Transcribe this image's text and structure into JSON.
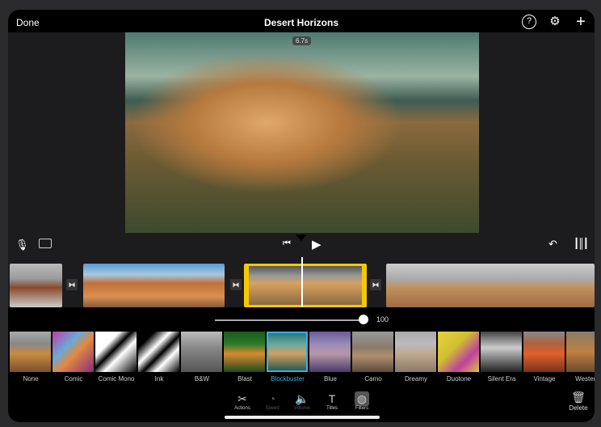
{
  "header": {
    "done_label": "Done",
    "title": "Desert Horizons",
    "icons": [
      "help-icon",
      "settings-icon",
      "add-icon"
    ]
  },
  "viewer": {
    "duration": "6.7s"
  },
  "timeline": {
    "icons": [
      "microphone-icon",
      "camera-icon",
      "skip-back-icon",
      "play-icon",
      "undo-icon",
      "audio-waveform-icon"
    ]
  },
  "slider": {
    "value": "100",
    "fraction": 1.0
  },
  "filters": {
    "selected": "Blockbuster",
    "items": [
      {
        "label": "None",
        "bg": "linear-gradient(#aaa 0%,#888 30%,#c88a40 55%,#7a5030 100%)"
      },
      {
        "label": "Comic",
        "bg": "linear-gradient(135deg,#c23aa0,#6aa8d8 35%,#e08a40 55%,#8a2a80 100%)"
      },
      {
        "label": "Comic Mono",
        "bg": "linear-gradient(135deg,#fff 30%,#000 45%,#fff 60%,#000 100%)"
      },
      {
        "label": "Ink",
        "bg": "linear-gradient(135deg,#000 20%,#fff 40%,#000 55%,#fff 70%,#000 100%)"
      },
      {
        "label": "B&W",
        "bg": "linear-gradient(#bbb,#888 40%,#555 100%)"
      },
      {
        "label": "Blast",
        "bg": "linear-gradient(#1a5a1a,#2a7a2a 30%,#d88a30 55%,#1e4a1e 100%)"
      },
      {
        "label": "Blockbuster",
        "bg": "linear-gradient(#2a7a7a,#6aa8a0 30%,#d0a060 55%,#2a5a50 100%)"
      },
      {
        "label": "Blue",
        "bg": "linear-gradient(#6a5a9a,#9a8ab8 30%,#b898a8 55%,#4a3a6a 100%)"
      },
      {
        "label": "Camo",
        "bg": "linear-gradient(#999,#8a7a6a 40%,#b09070 60%,#5a4a3a 100%)"
      },
      {
        "label": "Dreamy",
        "bg": "linear-gradient(#aaa,#bbb 30%,#c0a890 55%,#8a7a6a 100%)"
      },
      {
        "label": "Duotone",
        "bg": "linear-gradient(135deg,#e8d040,#d0c030 40%,#c040a0 70%,#d8c040 100%)"
      },
      {
        "label": "Silent Era",
        "bg": "linear-gradient(#444,#ccc 40%,#777 70%,#222 100%)"
      },
      {
        "label": "Vintage",
        "bg": "linear-gradient(#888,#b06040 30%,#e0602a 55%,#7a3020 100%)"
      },
      {
        "label": "Western",
        "bg": "linear-gradient(#8a7a6a,#c08040 50%,#6a4a30 100%)"
      }
    ]
  },
  "toolbar": {
    "items": [
      {
        "label": "Actions",
        "icon": "scissors-icon",
        "glyph": "✂",
        "enabled": true
      },
      {
        "label": "Speed",
        "icon": "speedometer-icon",
        "glyph": "◔",
        "enabled": false
      },
      {
        "label": "Volume",
        "icon": "speaker-icon",
        "glyph": "🔈",
        "enabled": false
      },
      {
        "label": "Titles",
        "icon": "text-icon",
        "glyph": "T",
        "enabled": true
      },
      {
        "label": "Filters",
        "icon": "filters-icon",
        "glyph": "◍",
        "enabled": true
      }
    ],
    "delete_label": "Delete"
  }
}
